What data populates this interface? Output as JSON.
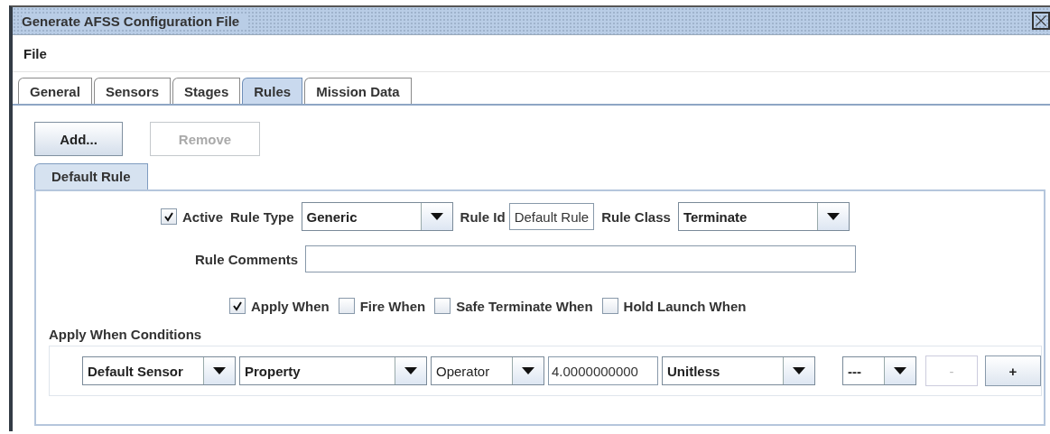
{
  "window": {
    "title": "Generate AFSS Configuration File"
  },
  "menu": [
    "File"
  ],
  "tabs": [
    {
      "label": "General",
      "selected": false
    },
    {
      "label": "Sensors",
      "selected": false
    },
    {
      "label": "Stages",
      "selected": false
    },
    {
      "label": "Rules",
      "selected": true
    },
    {
      "label": "Mission Data",
      "selected": false
    }
  ],
  "toolbar": [
    {
      "label": "Add...",
      "disabled": false
    },
    {
      "label": "Remove",
      "disabled": true
    }
  ],
  "rule_tabs": [
    {
      "label": "Default Rule",
      "selected": true
    }
  ],
  "rule": {
    "active": {
      "label": "Active",
      "checked": true
    },
    "rule_type": {
      "label": "Rule Type",
      "value": "Generic"
    },
    "rule_id": {
      "label": "Rule Id",
      "value": "Default Rule"
    },
    "rule_class": {
      "label": "Rule Class",
      "value": "Terminate"
    },
    "rule_comments": {
      "label": "Rule Comments"
    }
  },
  "when_options": [
    {
      "label": "Apply When",
      "checked": true
    },
    {
      "label": "Fire When",
      "checked": false
    },
    {
      "label": "Safe Terminate When",
      "checked": false
    },
    {
      "label": "Hold Launch When",
      "checked": false
    }
  ],
  "conditions": {
    "title": "Apply When Conditions",
    "items": [
      {
        "kind": "combo",
        "value": "Default Sensor",
        "bold": true
      },
      {
        "kind": "combo",
        "value": "Property",
        "bold": true
      },
      {
        "kind": "combo",
        "value": "Operator",
        "bold": false
      },
      {
        "kind": "field",
        "value": "4.0000000000"
      },
      {
        "kind": "combo",
        "value": "Unitless",
        "bold": true
      },
      {
        "kind": "combo",
        "value": "---",
        "bold": true
      },
      {
        "kind": "button",
        "label": "-",
        "disabled": true
      },
      {
        "kind": "button",
        "label": "+",
        "disabled": false
      }
    ]
  }
}
